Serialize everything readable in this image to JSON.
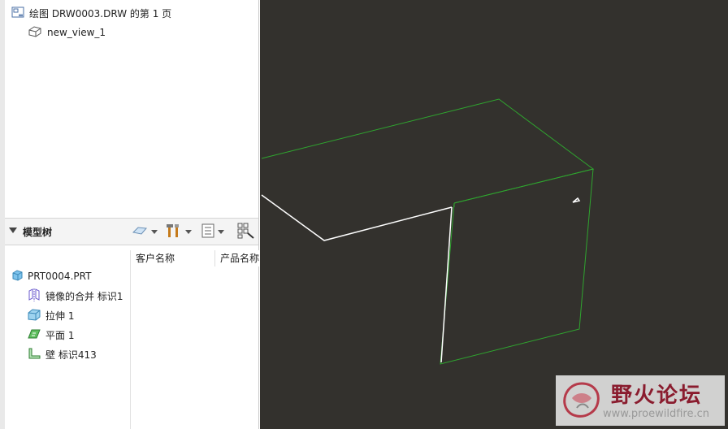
{
  "sheet_tree": {
    "sheet_label": "绘图 DRW0003.DRW 的第 1 页",
    "view_label": "new_view_1"
  },
  "model_tree": {
    "title": "模型树",
    "columns": [
      "客户名称",
      "产品名称"
    ],
    "root": "PRT0004.PRT",
    "items": [
      {
        "label": "镜像的合并 标识1",
        "icon": "mirror-merge-icon"
      },
      {
        "label": "拉伸 1",
        "icon": "extrude-icon"
      },
      {
        "label": "平面 1",
        "icon": "plane-icon"
      },
      {
        "label": "壁 标识413",
        "icon": "wall-icon"
      }
    ]
  },
  "viewport": {
    "background": "#33312d",
    "edge_color": "#2fa52f",
    "highlight_color": "#ffffff"
  },
  "watermark": {
    "title": "野火论坛",
    "url": "www.proewildfire.cn"
  }
}
